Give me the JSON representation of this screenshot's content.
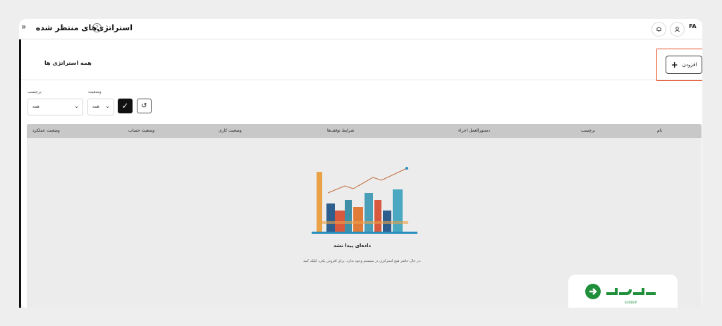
{
  "header": {
    "title": "استراتژی‌های منتظر شده",
    "collapse_icon": "»",
    "help_icon": "?",
    "bell_icon": "bell-icon",
    "user_icon": "user-icon",
    "language": "FA"
  },
  "section": {
    "title": "همه استراتژی ها",
    "add_label": "افزودن",
    "add_icon": "+"
  },
  "filters": {
    "tag_label": "برچسب",
    "tag_value": "همه",
    "status_label": "وضعیت",
    "status_value": "همه"
  },
  "table": {
    "columns": [
      "نام",
      "برچسب",
      "دستورالعمل اجراء",
      "شرایط توقف‌ها",
      "وضعیت کاری",
      "وضعیت حساب",
      "وضعیت عملکرد"
    ]
  },
  "empty": {
    "title": "داده‌ای پیدا نشد",
    "message": "در حال حاضر هیچ استراتژی در سیستم وجود ندارد. برای افزودن یکی، کلیک کنید."
  },
  "brand": {
    "name": "SOODUP",
    "colors": {
      "green": "#1f8f3a",
      "accent": "#e8532b"
    }
  }
}
